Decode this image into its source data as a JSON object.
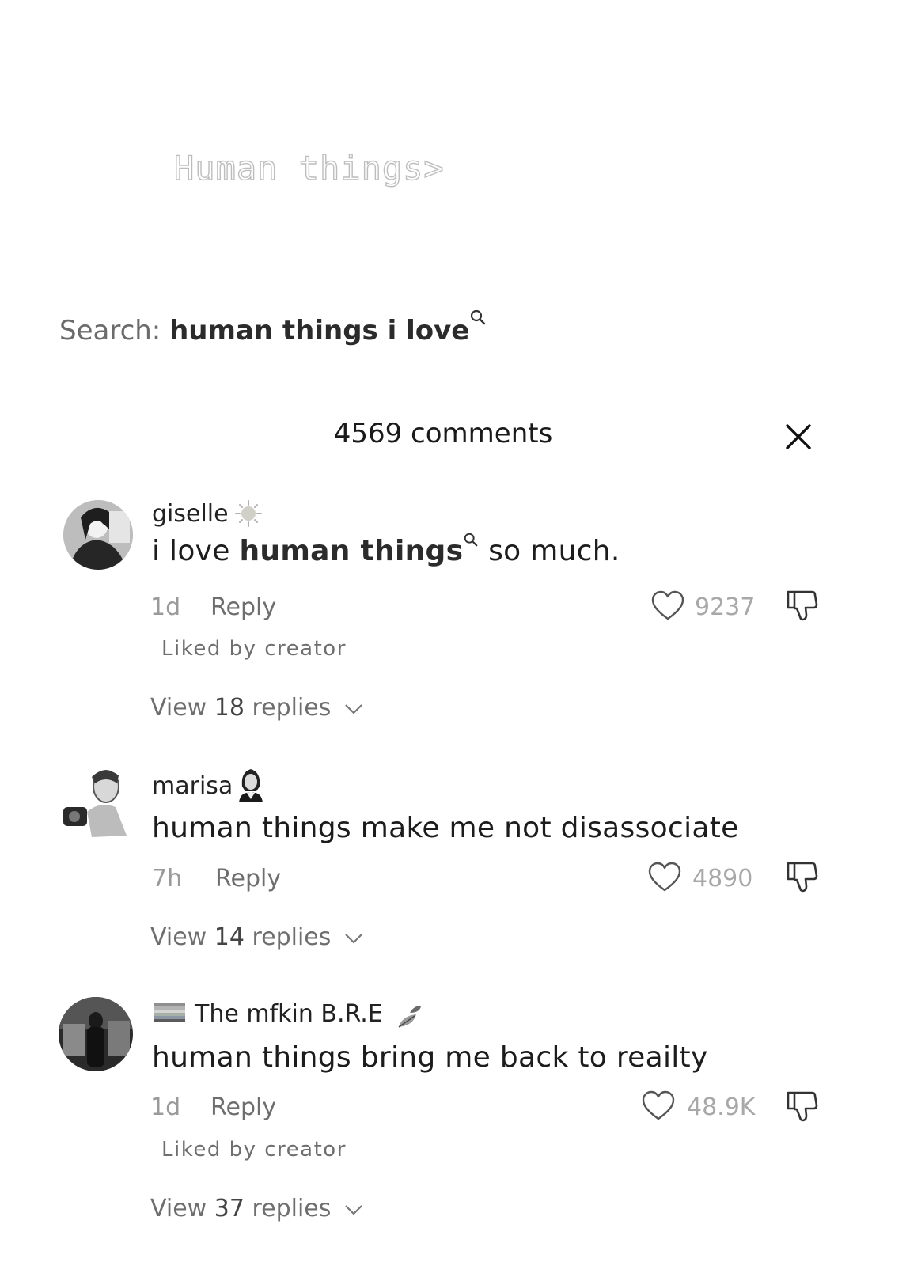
{
  "overlay": {
    "title": "Human things>"
  },
  "search": {
    "label": "Search:",
    "query": "human things i love"
  },
  "header": {
    "comments_count": "4569 comments"
  },
  "comments": [
    {
      "username": "giselle",
      "badge_icon": "sun-emoji-icon",
      "text_pre": "i love ",
      "text_highlight": "human things",
      "text_post": " so much.",
      "time": "1d",
      "reply_label": "Reply",
      "likes": "9237",
      "liked_by_creator": "Liked by creator",
      "view_replies_prefix": "View ",
      "view_replies_count": "18",
      "view_replies_suffix": " replies"
    },
    {
      "username": "marisa",
      "badge_icon": "vampire-emoji-icon",
      "text": "human things make me not disassociate",
      "time": "7h",
      "reply_label": "Reply",
      "likes": "4890",
      "view_replies_prefix": "View ",
      "view_replies_count": "14",
      "view_replies_suffix": " replies"
    },
    {
      "username": "The mfkin B.R.E",
      "flag_icon": "rainbow-flag-icon",
      "badge_icon": "leaf-emoji-icon",
      "text": "human things bring me back to reailty",
      "time": "1d",
      "reply_label": "Reply",
      "likes": "48.9K",
      "liked_by_creator": "Liked by creator",
      "view_replies_prefix": "View ",
      "view_replies_count": "37",
      "view_replies_suffix": " replies"
    }
  ]
}
